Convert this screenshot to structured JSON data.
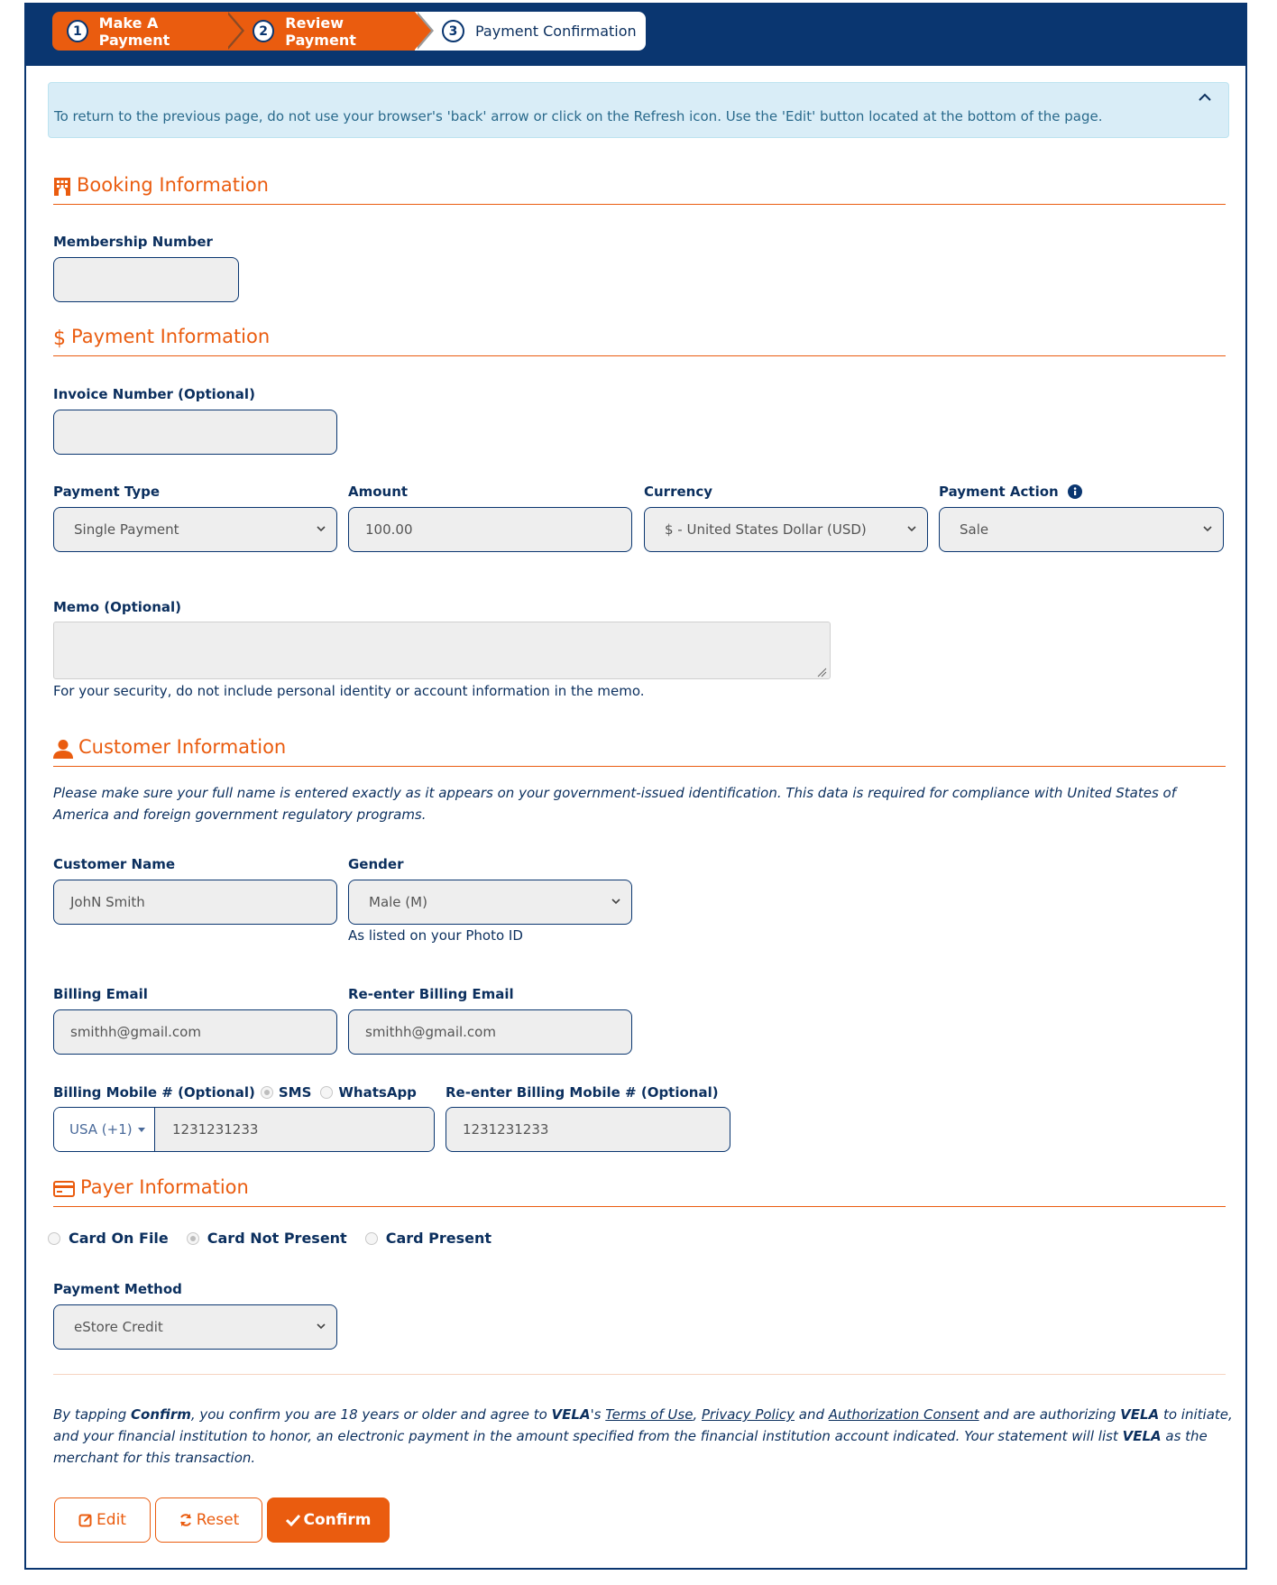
{
  "stepper": {
    "steps": [
      {
        "num": "1",
        "label": "Make A Payment"
      },
      {
        "num": "2",
        "label": "Review Payment"
      },
      {
        "num": "3",
        "label": "Payment Confirmation"
      }
    ]
  },
  "alert": {
    "text": "To return to the previous page, do not use your browser's 'back' arrow or click on the Refresh icon. Use the 'Edit' button located at the bottom of the page.",
    "collapse_icon": "chevron-up-icon"
  },
  "booking": {
    "title": "Booking Information",
    "icon": "building-icon",
    "membership_label": "Membership Number",
    "membership_value": ""
  },
  "payment": {
    "title": "Payment Information",
    "icon": "dollar-icon",
    "invoice_label": "Invoice Number (Optional)",
    "invoice_value": "",
    "payment_type_label": "Payment Type",
    "payment_type_value": "Single Payment",
    "amount_label": "Amount",
    "amount_value": "100.00",
    "currency_label": "Currency",
    "currency_value": "$ - United States Dollar (USD)",
    "action_label": "Payment Action",
    "action_value": "Sale",
    "memo_label": "Memo (Optional)",
    "memo_value": "",
    "memo_help": "For your security, do not include personal identity or account information in the memo."
  },
  "customer": {
    "title": "Customer Information",
    "icon": "user-icon",
    "note": "Please make sure your full name is entered exactly as it appears on your government-issued identification. This data is required for compliance with United States of America and foreign government regulatory programs.",
    "name_label": "Customer Name",
    "name_value": "JohN Smith",
    "gender_label": "Gender",
    "gender_value": "Male (M)",
    "gender_help": "As listed on your Photo ID",
    "email_label": "Billing Email",
    "email_value": "smithh@gmail.com",
    "reemail_label": "Re-enter Billing Email",
    "reemail_value": "smithh@gmail.com",
    "mobile_label": "Billing Mobile # (Optional)",
    "sms_label": "SMS",
    "whatsapp_label": "WhatsApp",
    "country_code": "USA (+1)",
    "mobile_value": "1231231233",
    "remobile_label": "Re-enter Billing Mobile # (Optional)",
    "remobile_value": "1231231233"
  },
  "payer": {
    "title": "Payer Information",
    "icon": "credit-card-icon",
    "options": [
      "Card On File",
      "Card Not Present",
      "Card Present"
    ],
    "selected": "Card Not Present",
    "method_label": "Payment Method",
    "method_value": "eStore Credit"
  },
  "consent": {
    "p1": "By tapping ",
    "confirm_word": "Confirm",
    "p2": ", you confirm you are 18 years or older and agree to ",
    "vela1": "VELA",
    "p3": "'s ",
    "terms": "Terms of Use",
    "comma": ", ",
    "privacy": "Privacy Policy",
    "and": " and ",
    "auth": "Authorization Consent",
    "p4": " and are authorizing ",
    "vela2": "VELA",
    "p5": " to initiate, and your financial institution to honor, an electronic payment in the amount specified from the financial institution account indicated. Your statement will list ",
    "vela3": "VELA",
    "p6": " as the merchant for this transaction."
  },
  "buttons": {
    "edit": "Edit",
    "reset": "Reset",
    "confirm": "Confirm"
  },
  "colors": {
    "brand_navy": "#0a3670",
    "accent_orange": "#ea5c0f",
    "alert_bg": "#d9edf7"
  }
}
